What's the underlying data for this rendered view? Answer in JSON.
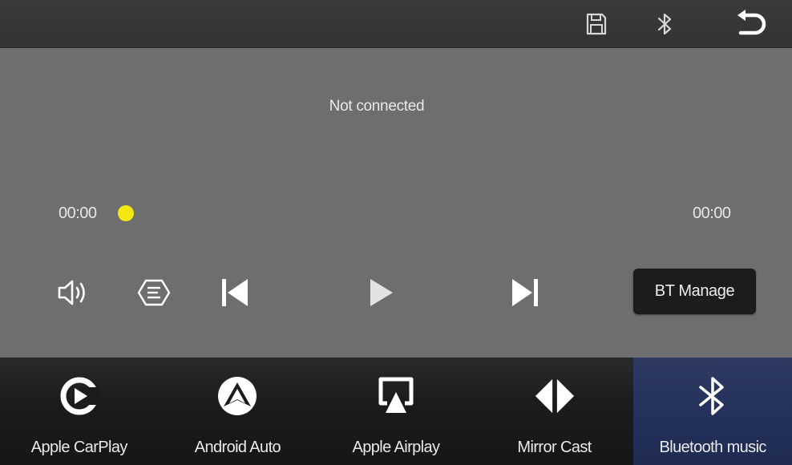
{
  "topbar": {
    "icons": [
      "save-icon",
      "bluetooth-icon",
      "back-icon"
    ]
  },
  "player": {
    "status": "Not connected",
    "time_elapsed": "00:00",
    "time_total": "00:00",
    "progress": 0,
    "bt_manage_label": "BT Manage"
  },
  "controls": [
    "volume-icon",
    "playlist-icon",
    "previous-icon",
    "play-icon",
    "next-icon"
  ],
  "dock": {
    "items": [
      {
        "label": "Apple CarPlay",
        "icon": "carplay-icon"
      },
      {
        "label": "Android Auto",
        "icon": "android-auto-icon"
      },
      {
        "label": "Apple Airplay",
        "icon": "airplay-icon"
      },
      {
        "label": "Mirror Cast",
        "icon": "mirror-cast-icon"
      },
      {
        "label": "Bluetooth music",
        "icon": "bluetooth-music-icon"
      }
    ],
    "active_index": 4,
    "active_color": "#24305a"
  },
  "colors": {
    "background": "#6e6e6e",
    "topbar": "#363636",
    "progress_thumb": "#f2e810"
  }
}
